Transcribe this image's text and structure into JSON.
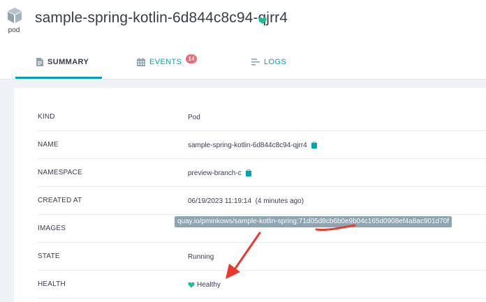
{
  "header": {
    "icon_label": "pod",
    "title": "sample-spring-kotlin-6d844c8c94-qjrr4",
    "status_icon": "heart-icon",
    "status_color": "#18be94"
  },
  "tabs": [
    {
      "label": "SUMMARY",
      "icon": "document-icon",
      "active": true
    },
    {
      "label": "EVENTS",
      "icon": "calendar-icon",
      "badge": "14"
    },
    {
      "label": "LOGS",
      "icon": "logs-icon"
    }
  ],
  "summary": {
    "kind": {
      "label": "KIND",
      "value": "Pod"
    },
    "name": {
      "label": "NAME",
      "value": "sample-spring-kotlin-6d844c8c94-qjrr4"
    },
    "namespace": {
      "label": "NAMESPACE",
      "value": "preview-branch-c"
    },
    "created_at": {
      "label": "CREATED AT",
      "value": "06/19/2023 11:19:14  (4 minutes ago)"
    },
    "images": {
      "label": "IMAGES",
      "value": "quay.io/pminkows/sample-kotlin-spring:71d05d8cb6b0e9b04c165d0908ef4a8ac901d70f"
    },
    "state": {
      "label": "STATE",
      "value": "Running"
    },
    "health": {
      "label": "HEALTH",
      "value": "Healthy"
    }
  },
  "colors": {
    "accent": "#00a2b3",
    "badge": "#e96d76",
    "healthy": "#18be94",
    "annotation": "#e8392c"
  }
}
